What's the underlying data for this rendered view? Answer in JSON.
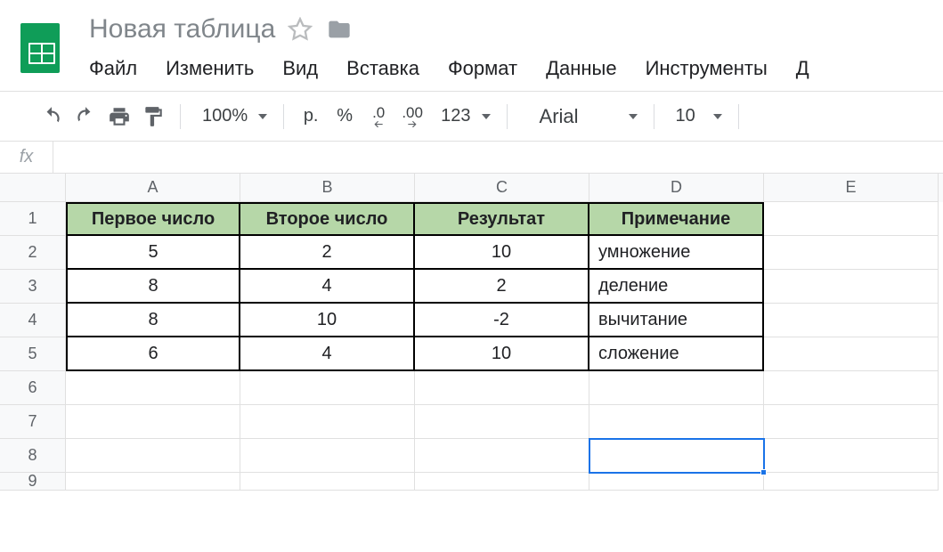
{
  "doc_title": "Новая таблица",
  "menu": {
    "file": "Файл",
    "edit": "Изменить",
    "view": "Вид",
    "insert": "Вставка",
    "format": "Формат",
    "data": "Данные",
    "tools": "Инструменты",
    "addons_cut": "Д"
  },
  "toolbar": {
    "zoom": "100%",
    "currency": "р.",
    "percent": "%",
    "dec_less": ".0",
    "dec_more": ".00",
    "num_format": "123",
    "font": "Arial",
    "font_size": "10"
  },
  "formula_bar": {
    "fx": "fx",
    "value": ""
  },
  "columns": [
    "A",
    "B",
    "C",
    "D",
    "E"
  ],
  "row_numbers": [
    "1",
    "2",
    "3",
    "4",
    "5",
    "6",
    "7",
    "8",
    "9"
  ],
  "table": {
    "headers": {
      "a": "Первое число",
      "b": "Второе число",
      "c": "Результат",
      "d": "Примечание"
    },
    "rows": [
      {
        "a": "5",
        "b": "2",
        "c": "10",
        "d": "умножение"
      },
      {
        "a": "8",
        "b": "4",
        "c": "2",
        "d": "деление"
      },
      {
        "a": "8",
        "b": "10",
        "c": "-2",
        "d": "вычитание"
      },
      {
        "a": "6",
        "b": "4",
        "c": "10",
        "d": "сложение"
      }
    ]
  },
  "selected_cell": "D8"
}
